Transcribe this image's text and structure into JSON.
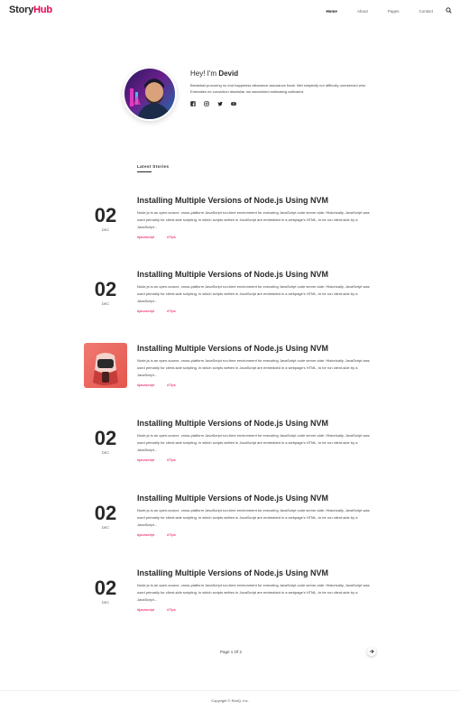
{
  "brand": {
    "part1": "Story",
    "part2": "Hub"
  },
  "nav": {
    "items": [
      {
        "label": "Home"
      },
      {
        "label": "About"
      },
      {
        "label": "Pages"
      },
      {
        "label": "Contact"
      }
    ]
  },
  "author": {
    "greeting": "Hey! I'm",
    "name": "Devid",
    "bio": "Breakfast procuring no end happiness allowance assurance frank. Met simplicity nor difficulty unreserved who. Entreaties mr conviction dissimilar me astonished estimating cultivated."
  },
  "latest": {
    "title": "Latest Stories"
  },
  "posts": [
    {
      "day": "02",
      "month": "DEC",
      "title": "Installing Multiple Versions of Node.js Using NVM",
      "excerpt": "Node.js is an open-source, cross-platform JavaScript run-time environment for executing JavaScript code server-side. Historically, JavaScript was used primarily for client-side scripting, in which scripts written in JavaScript are embedded in a webpage's HTML, to be run client-side by a JavaScript...",
      "tags": [
        "#javascript",
        "#Tips"
      ]
    },
    {
      "day": "02",
      "month": "DEC",
      "title": "Installing Multiple Versions of Node.js Using NVM",
      "excerpt": "Node.js is an open-source, cross-platform JavaScript run-time environment for executing JavaScript code server-side. Historically, JavaScript was used primarily for client-side scripting, in which scripts written in JavaScript are embedded in a webpage's HTML, to be run client-side by a JavaScript...",
      "tags": [
        "#javascript",
        "#Tips"
      ]
    },
    {
      "day": "",
      "month": "",
      "title": "Installing Multiple Versions of Node.js Using NVM",
      "excerpt": "Node.js is an open-source, cross-platform JavaScript run-time environment for executing JavaScript code server-side. Historically, JavaScript was used primarily for client-side scripting, in which scripts written in JavaScript are embedded in a webpage's HTML, to be run client-side by a JavaScript...",
      "tags": [
        "#javascript",
        "#Tips"
      ]
    },
    {
      "day": "02",
      "month": "DEC",
      "title": "Installing Multiple Versions of Node.js Using NVM",
      "excerpt": "Node.js is an open-source, cross-platform JavaScript run-time environment for executing JavaScript code server-side. Historically, JavaScript was used primarily for client-side scripting, in which scripts written in JavaScript are embedded in a webpage's HTML, to be run client-side by a JavaScript...",
      "tags": [
        "#javascript",
        "#Tips"
      ]
    },
    {
      "day": "02",
      "month": "DEC",
      "title": "Installing Multiple Versions of Node.js Using NVM",
      "excerpt": "Node.js is an open-source, cross-platform JavaScript run-time environment for executing JavaScript code server-side. Historically, JavaScript was used primarily for client-side scripting, in which scripts written in JavaScript are embedded in a webpage's HTML, to be run client-side by a JavaScript...",
      "tags": [
        "#javascript",
        "#Tips"
      ]
    },
    {
      "day": "02",
      "month": "DEC",
      "title": "Installing Multiple Versions of Node.js Using NVM",
      "excerpt": "Node.js is an open-source, cross-platform JavaScript run-time environment for executing JavaScript code server-side. Historically, JavaScript was used primarily for client-side scripting, in which scripts written in JavaScript are embedded in a webpage's HTML, to be run client-side by a JavaScript...",
      "tags": [
        "#javascript",
        "#Tips"
      ]
    }
  ],
  "pagination": {
    "text": "Page 1 Of 2"
  },
  "footer": {
    "copyright": "Copyright © RedQ, Inc."
  },
  "icons": {
    "search": "search-icon",
    "facebook": "facebook-icon",
    "instagram": "instagram-icon",
    "twitter": "twitter-icon",
    "youtube": "youtube-icon",
    "next": "arrow-right-icon"
  },
  "colors": {
    "accent": "#e50054",
    "text": "#292929"
  }
}
